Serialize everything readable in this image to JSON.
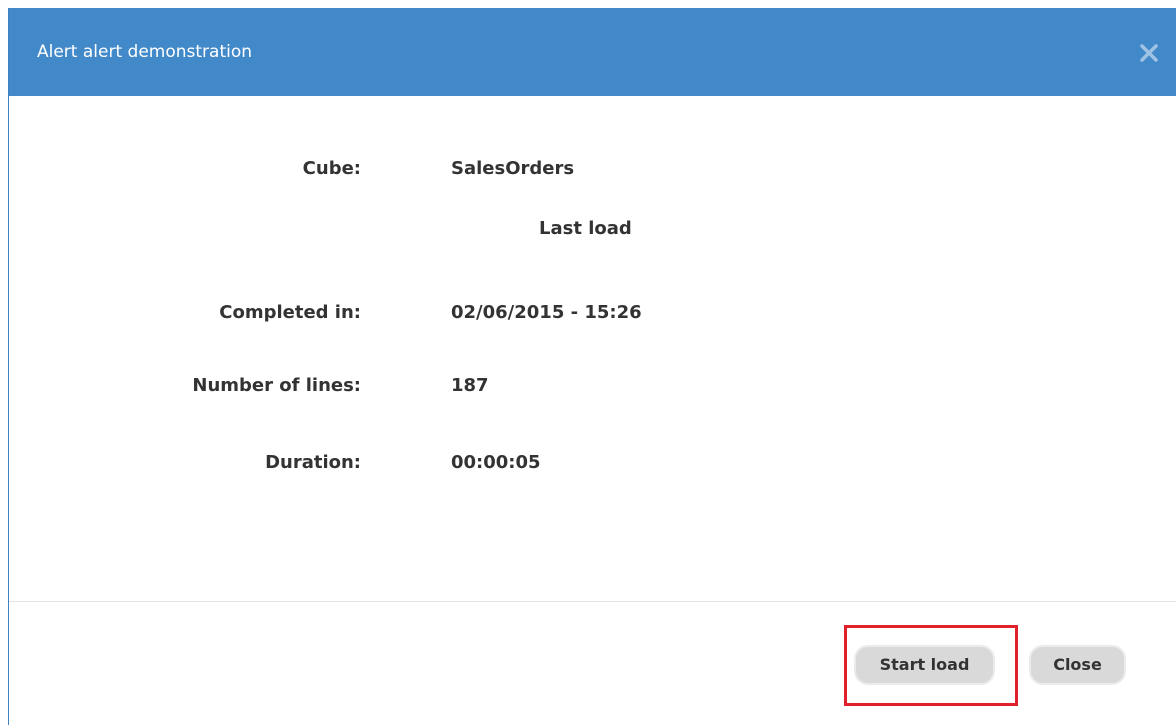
{
  "dialog": {
    "title": "Alert alert demonstration",
    "close_icon": "close-icon"
  },
  "details": {
    "cube_label": "Cube:",
    "cube_value": "SalesOrders",
    "section_heading": "Last load",
    "completed_label": "Completed in:",
    "completed_value": "02/06/2015 - 15:26",
    "lines_label": "Number of lines:",
    "lines_value": "187",
    "duration_label": "Duration:",
    "duration_value": "00:00:05"
  },
  "footer": {
    "start_load_label": "Start load",
    "close_label": "Close"
  },
  "colors": {
    "titlebar": "#4289c9",
    "highlight": "#e0212b"
  }
}
